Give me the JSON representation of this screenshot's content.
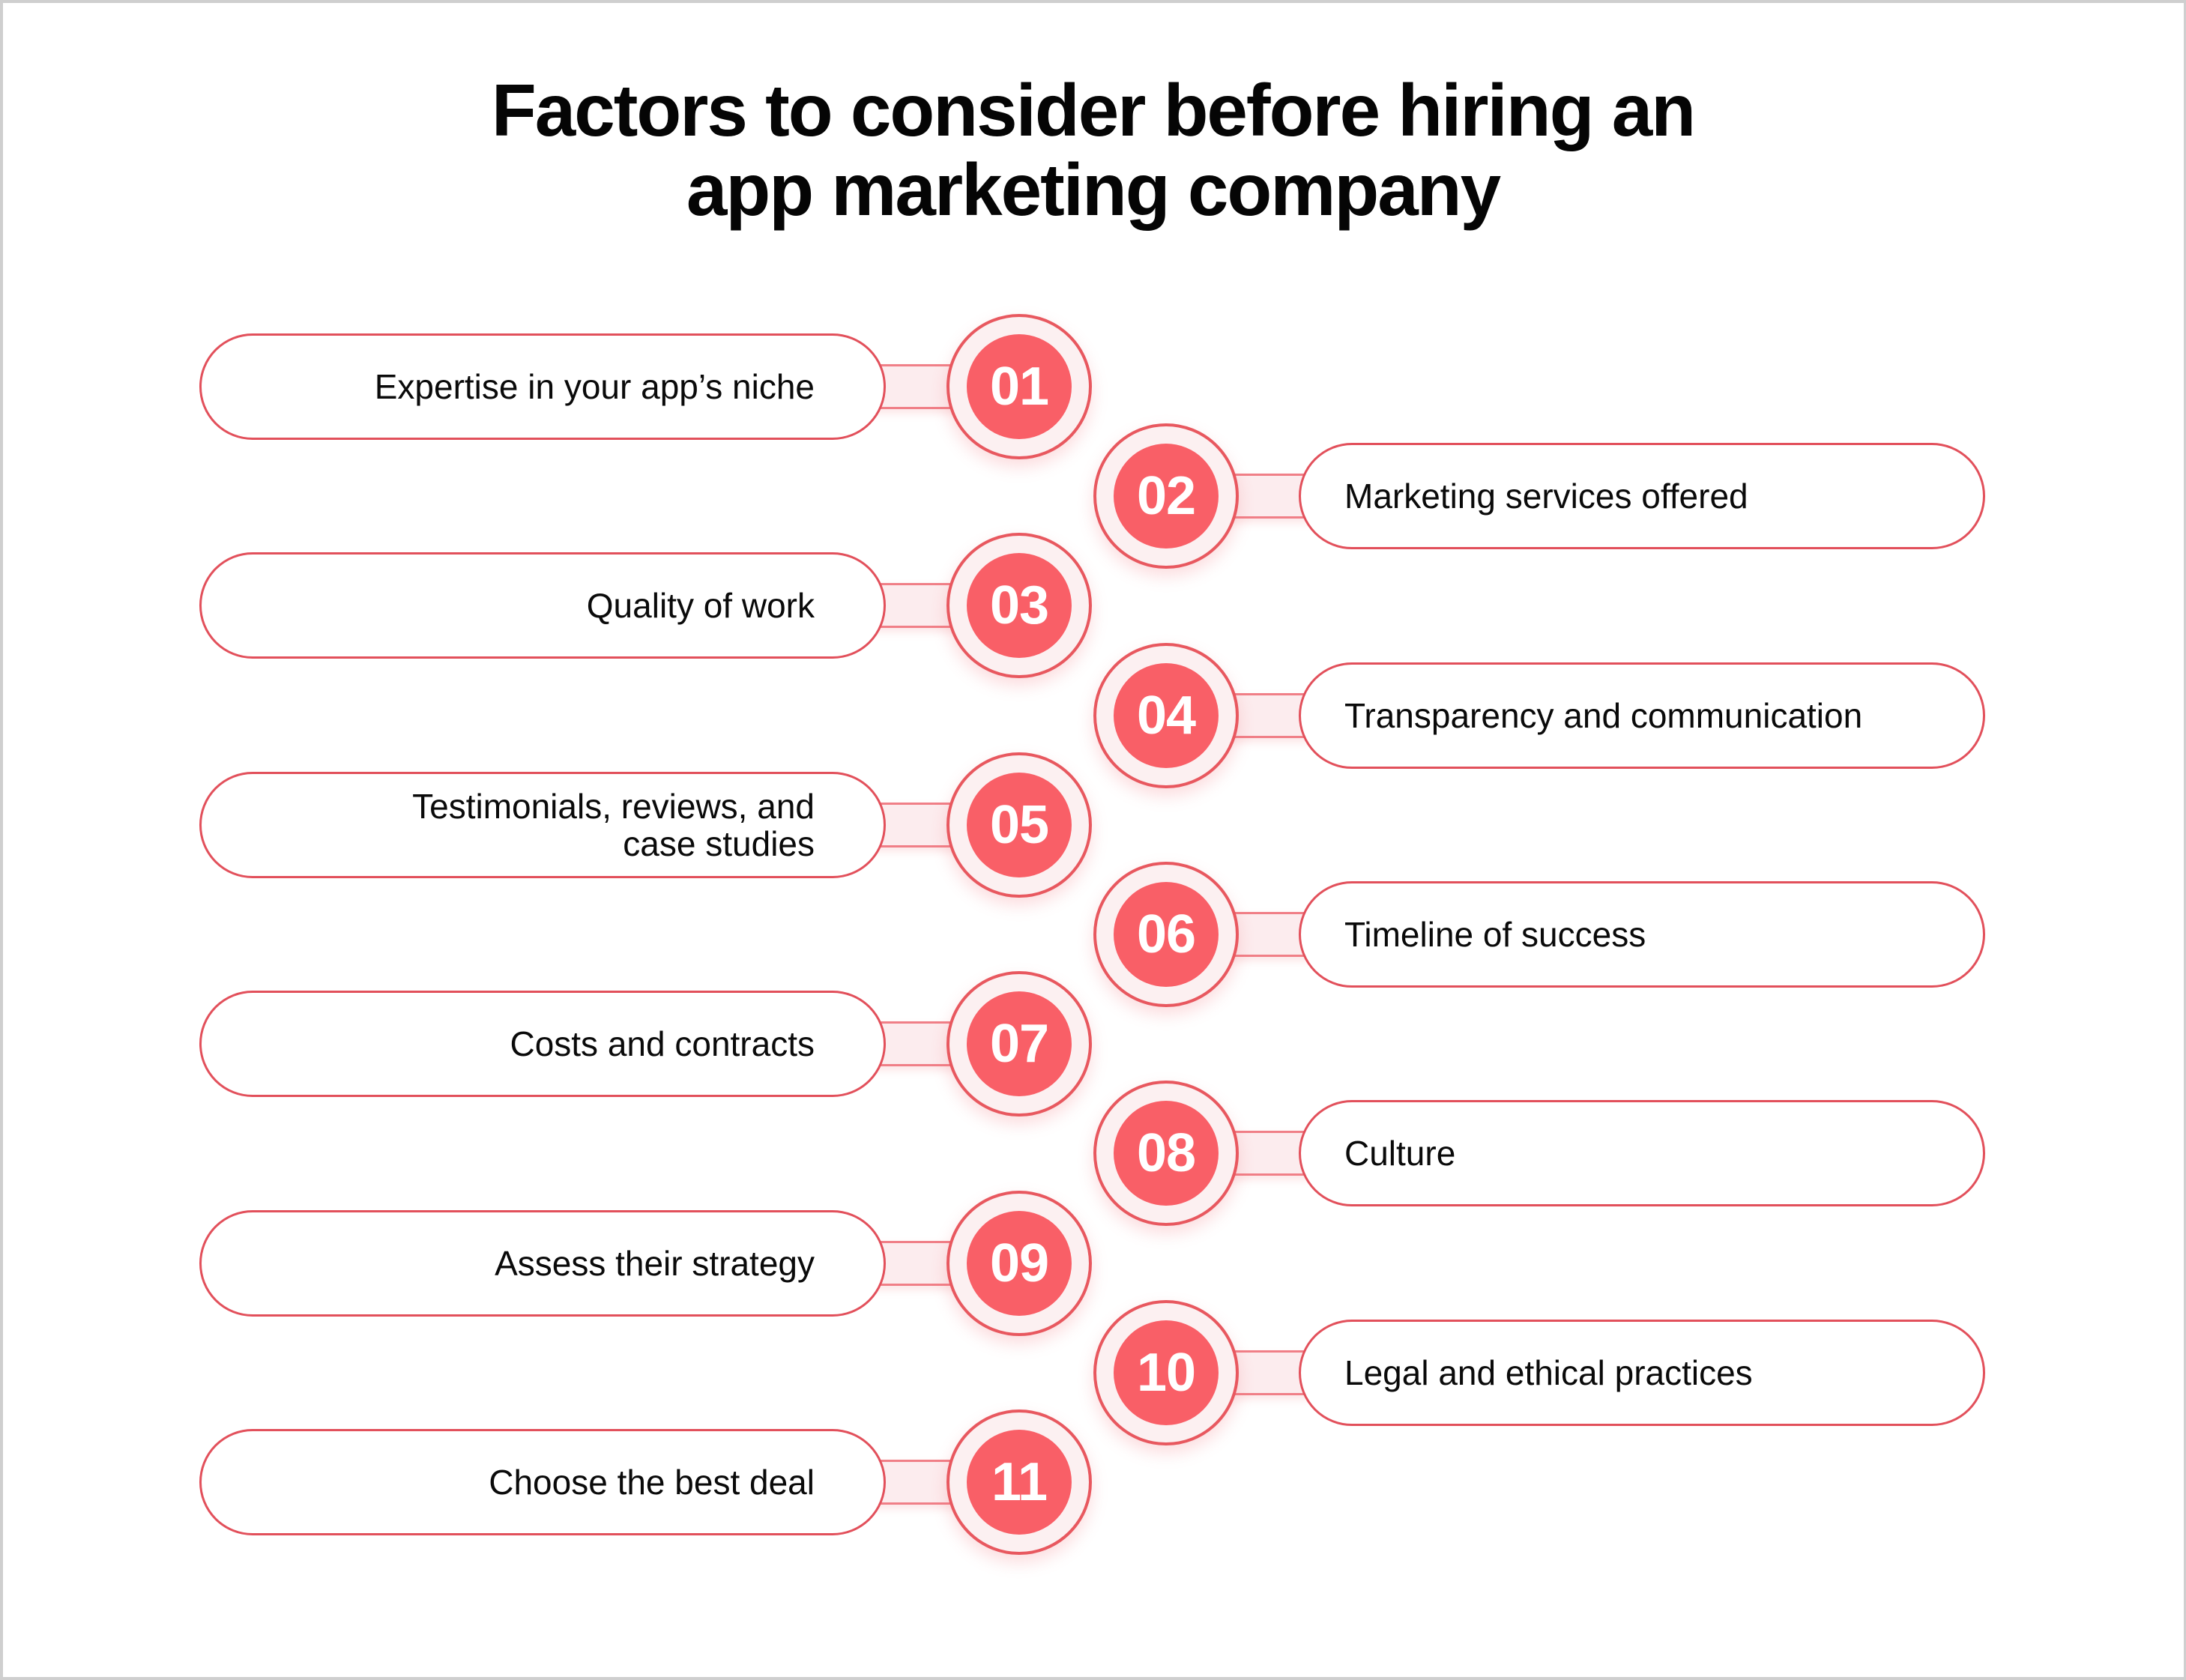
{
  "title": {
    "line1": "Factors to consider before hiring an",
    "line2": "app marketing company"
  },
  "colors": {
    "badge_fill": "#F95F67",
    "ring_fill": "#FCF0F1",
    "accent_stroke": "#E2505B",
    "text": "#0A0A0A",
    "background": "#FFFFFF"
  },
  "factors": [
    {
      "number": "01",
      "label": "Expertise in your app’s niche",
      "side": "left"
    },
    {
      "number": "02",
      "label": "Marketing services offered",
      "side": "right"
    },
    {
      "number": "03",
      "label": "Quality of work",
      "side": "left"
    },
    {
      "number": "04",
      "label": "Transparency and communication",
      "side": "right"
    },
    {
      "number": "05",
      "label": "Testimonials, reviews, and case studies",
      "side": "left"
    },
    {
      "number": "06",
      "label": "Timeline of success",
      "side": "right"
    },
    {
      "number": "07",
      "label": "Costs and contracts",
      "side": "left"
    },
    {
      "number": "08",
      "label": "Culture",
      "side": "right"
    },
    {
      "number": "09",
      "label": "Assess their strategy",
      "side": "left"
    },
    {
      "number": "10",
      "label": "Legal and ethical practices",
      "side": "right"
    },
    {
      "number": "11",
      "label": "Choose the best deal",
      "side": "left"
    }
  ]
}
